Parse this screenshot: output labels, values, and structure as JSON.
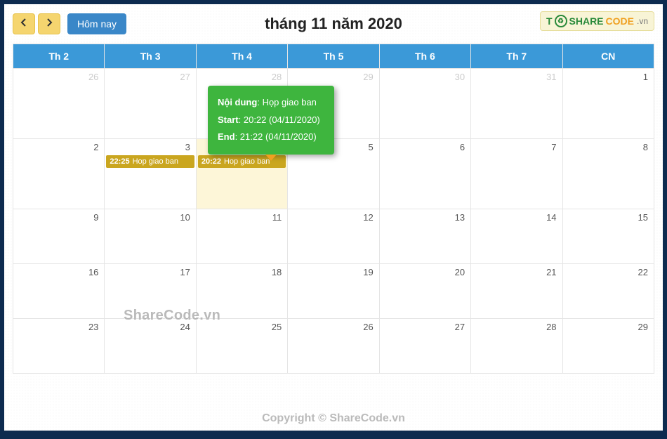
{
  "toolbar": {
    "today_label": "Hôm nay",
    "title": "tháng 11 năm 2020"
  },
  "logo": {
    "prefix": "T",
    "brand_green": "SHARE",
    "brand_orange": "CODE",
    "ext": ".vn"
  },
  "days_header": [
    "Th 2",
    "Th 3",
    "Th 4",
    "Th 5",
    "Th 6",
    "Th 7",
    "CN"
  ],
  "weeks": [
    {
      "days": [
        {
          "num": "26",
          "other": true
        },
        {
          "num": "27",
          "other": true
        },
        {
          "num": "28",
          "other": true
        },
        {
          "num": "29",
          "other": true
        },
        {
          "num": "30",
          "other": true
        },
        {
          "num": "31",
          "other": true
        },
        {
          "num": "1"
        }
      ]
    },
    {
      "days": [
        {
          "num": "2"
        },
        {
          "num": "3",
          "events": [
            {
              "time": "22:25",
              "title": "Hop giao ban"
            }
          ]
        },
        {
          "num": "4",
          "highlight": true,
          "events": [
            {
              "time": "20:22",
              "title": "Hop giao ban"
            }
          ]
        },
        {
          "num": "5"
        },
        {
          "num": "6"
        },
        {
          "num": "7"
        },
        {
          "num": "8"
        }
      ]
    },
    {
      "short": true,
      "days": [
        {
          "num": "9"
        },
        {
          "num": "10"
        },
        {
          "num": "11"
        },
        {
          "num": "12"
        },
        {
          "num": "13"
        },
        {
          "num": "14"
        },
        {
          "num": "15"
        }
      ]
    },
    {
      "short": true,
      "days": [
        {
          "num": "16"
        },
        {
          "num": "17"
        },
        {
          "num": "18"
        },
        {
          "num": "19"
        },
        {
          "num": "20"
        },
        {
          "num": "21"
        },
        {
          "num": "22"
        }
      ]
    },
    {
      "short": true,
      "days": [
        {
          "num": "23"
        },
        {
          "num": "24"
        },
        {
          "num": "25"
        },
        {
          "num": "26"
        },
        {
          "num": "27"
        },
        {
          "num": "28"
        },
        {
          "num": "29"
        }
      ]
    }
  ],
  "tooltip": {
    "content_label": "Nội dung",
    "content_value": "Họp giao ban",
    "start_label": "Start",
    "start_value": "20:22 (04/11/2020)",
    "end_label": "End",
    "end_value": "21:22 (04/11/2020)"
  },
  "watermark": "ShareCode.vn",
  "footer": "Copyright © ShareCode.vn"
}
